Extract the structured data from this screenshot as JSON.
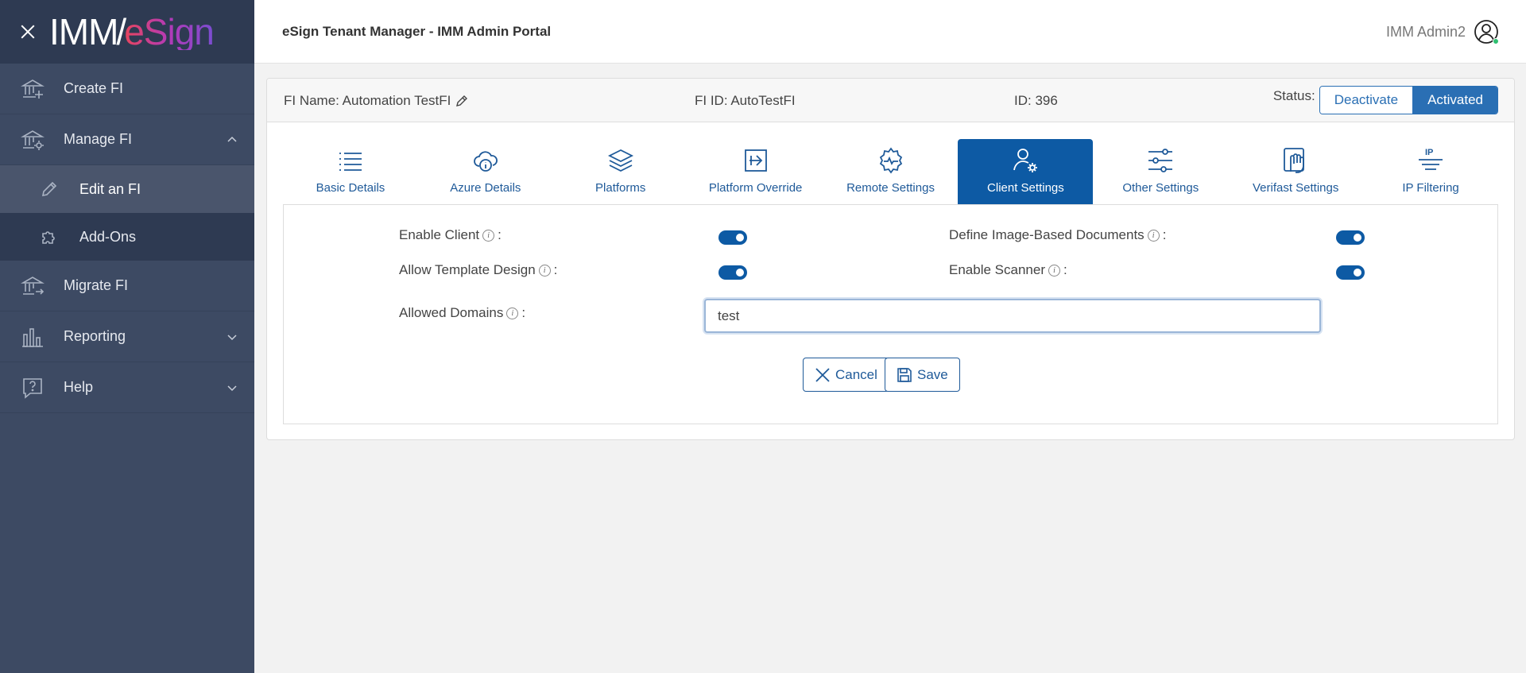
{
  "sidebar": {
    "logo_imm": "IMM",
    "logo_slash": "/",
    "logo_esign": "eSign",
    "items": [
      {
        "label": "Create FI",
        "icon": "bank-plus-icon"
      },
      {
        "label": "Manage FI",
        "icon": "bank-gear-icon",
        "expanded": true
      },
      {
        "label": "Edit an FI",
        "icon": "pencil-icon",
        "sub": true,
        "selected": true
      },
      {
        "label": "Add-Ons",
        "icon": "puzzle-icon",
        "sub": true
      },
      {
        "label": "Migrate FI",
        "icon": "bank-arrow-icon"
      },
      {
        "label": "Reporting",
        "icon": "bar-chart-icon"
      },
      {
        "label": "Help",
        "icon": "help-icon"
      }
    ]
  },
  "header": {
    "title": "eSign Tenant Manager - IMM Admin Portal",
    "user": "IMM Admin2"
  },
  "info": {
    "fi_name": "FI Name: Automation TestFI",
    "fi_id": "FI ID: AutoTestFI",
    "id": "ID: 396",
    "status_label": "Status:",
    "deactivate": "Deactivate",
    "activated": "Activated"
  },
  "tabs": [
    {
      "label": "Basic Details",
      "icon": "list-icon"
    },
    {
      "label": "Azure Details",
      "icon": "cloud-info-icon"
    },
    {
      "label": "Platforms",
      "icon": "layers-icon"
    },
    {
      "label": "Platform Override",
      "icon": "arrow-box-icon"
    },
    {
      "label": "Remote Settings",
      "icon": "gear-pulse-icon"
    },
    {
      "label": "Client Settings",
      "icon": "user-gear-icon",
      "active": true
    },
    {
      "label": "Other Settings",
      "icon": "sliders-icon"
    },
    {
      "label": "Verifast Settings",
      "icon": "hand-icon"
    },
    {
      "label": "IP Filtering",
      "icon": "ip-filter-icon"
    }
  ],
  "settings": {
    "enable_client": "Enable Client",
    "allow_template_design": "Allow Template Design",
    "define_image_docs": "Define Image-Based Documents",
    "enable_scanner": "Enable Scanner",
    "allowed_domains": "Allowed Domains",
    "allowed_domains_value": "test",
    "colon": ":",
    "info_glyph": "i"
  },
  "buttons": {
    "cancel": "Cancel",
    "save": "Save"
  },
  "colors": {
    "sidebar": "#3d4a63",
    "accent": "#0d5aa4"
  }
}
